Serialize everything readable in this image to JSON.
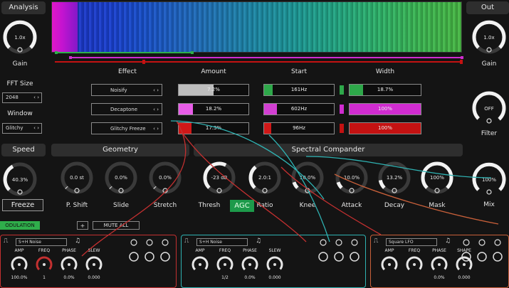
{
  "left": {
    "analysis_title": "Analysis",
    "gain_value": "1.0x",
    "gain_label": "Gain",
    "fft_label": "FFT Size",
    "fft_value": "2048",
    "window_label": "Window",
    "window_value": "Glitchy",
    "speed_title": "Speed",
    "speed_value": "40.3%",
    "freeze_label": "Freeze"
  },
  "right": {
    "out_title": "Out",
    "gain_value": "1.0x",
    "gain_label": "Gain",
    "filter_value": "OFF",
    "filter_label": "Filter",
    "mix_value": "100%",
    "mix_label": "Mix"
  },
  "effects": {
    "headers": {
      "effect": "Effect",
      "amount": "Amount",
      "start": "Start",
      "width": "Width"
    },
    "rows": [
      {
        "name": "Noisify",
        "amount": "7.2%",
        "amount_frac": 0.5,
        "amount_color": "#bdbdbd",
        "start": "161Hz",
        "start_frac": 0.12,
        "start_color": "#2ea84a",
        "width": "18.7%",
        "width_frac": 0.19,
        "width_color": "#2ea84a"
      },
      {
        "name": "Decaptone",
        "amount": "18.2%",
        "amount_frac": 0.2,
        "amount_color": "#e85de8",
        "start": "602Hz",
        "start_frac": 0.18,
        "start_color": "#d23fd2",
        "width": "100%",
        "width_frac": 1.0,
        "width_color": "#d02cd0"
      },
      {
        "name": "Glitchy Freeze",
        "amount": "17.3%",
        "amount_frac": 0.18,
        "amount_color": "#d01818",
        "start": "96Hz",
        "start_frac": 0.1,
        "start_color": "#d01818",
        "width": "100%",
        "width_frac": 1.0,
        "width_color": "#c41212"
      }
    ]
  },
  "geometry": {
    "title": "Geometry",
    "knobs": [
      {
        "value": "0.0 st",
        "label": "P. Shift"
      },
      {
        "value": "0.0%",
        "label": "Slide"
      },
      {
        "value": "0.0%",
        "label": "Stretch"
      }
    ]
  },
  "compander": {
    "title": "Spectral Compander",
    "knobs": [
      {
        "value": "-23 dB",
        "label": "Thresh",
        "frac": 0.6
      },
      {
        "value": "2.0:1",
        "label": "Ratio",
        "frac": 0.35
      },
      {
        "value": "10.0%",
        "label": "Knee",
        "frac": 0.1
      },
      {
        "value": "10.0%",
        "label": "Attack",
        "frac": 0.1
      },
      {
        "value": "13.2%",
        "label": "Decay",
        "frac": 0.13
      },
      {
        "value": "100%",
        "label": "Mask",
        "frac": 1.0
      }
    ],
    "agc_label": "AGC"
  },
  "modulation": {
    "tab_label": "ODULATION",
    "add_label": "+",
    "mute_all_label": "MUTE ALL",
    "modules": [
      {
        "type": "S+H Noise",
        "knobs": [
          "AMP",
          "FREQ",
          "PHASE",
          "SLEW"
        ],
        "values": [
          "100.0%",
          "1",
          "0.0%",
          "0.000"
        ],
        "color": "#c43030"
      },
      {
        "type": "S+H Noise",
        "knobs": [
          "AMP",
          "FREQ",
          "PHASE",
          "SLEW"
        ],
        "values": [
          "",
          "1/2",
          "0.0%",
          "0.000"
        ],
        "color": "#2fb3b3"
      },
      {
        "type": "Square LFO",
        "knobs": [
          "AMP",
          "FREQ",
          "PHASE",
          "SHAPE"
        ],
        "values": [
          "",
          "",
          "0.0%",
          "0.000"
        ],
        "color": "#c9603a"
      }
    ]
  },
  "colors": {
    "green": "#2fae4b",
    "magenta": "#d02cd0",
    "red": "#c41212",
    "teal": "#2fb3b3",
    "orange": "#c9603a"
  }
}
